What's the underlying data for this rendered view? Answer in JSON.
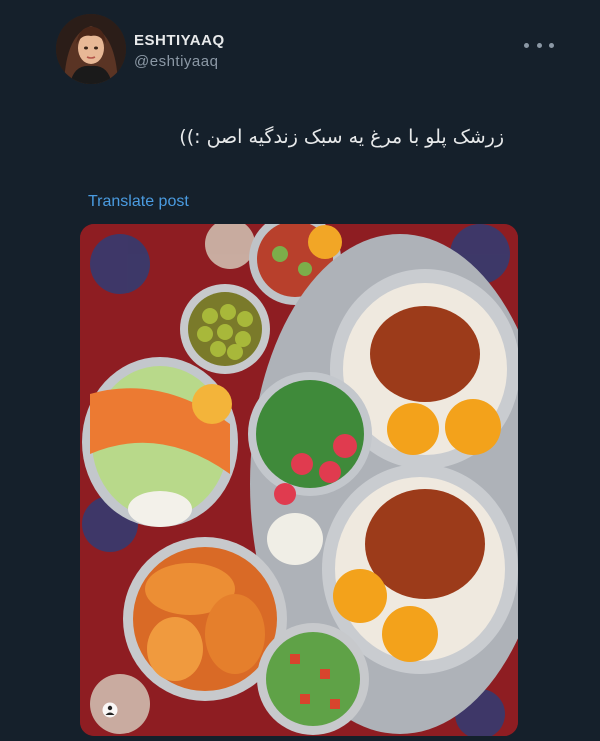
{
  "post": {
    "author": {
      "display_name": "ESHTIYAAQ",
      "handle": "@eshtiyaaq"
    },
    "text": "زرشک پلو با مرغ یه سبک زندگیه اصن :))",
    "translate_label": "Translate post",
    "media": {
      "icon": "food-photo-image"
    },
    "more_icon": "more-options-icon"
  },
  "colors": {
    "background": "#15202b",
    "primary_text": "#e7e9ea",
    "secondary_text": "#8b98a5",
    "link": "#4a9be0"
  }
}
